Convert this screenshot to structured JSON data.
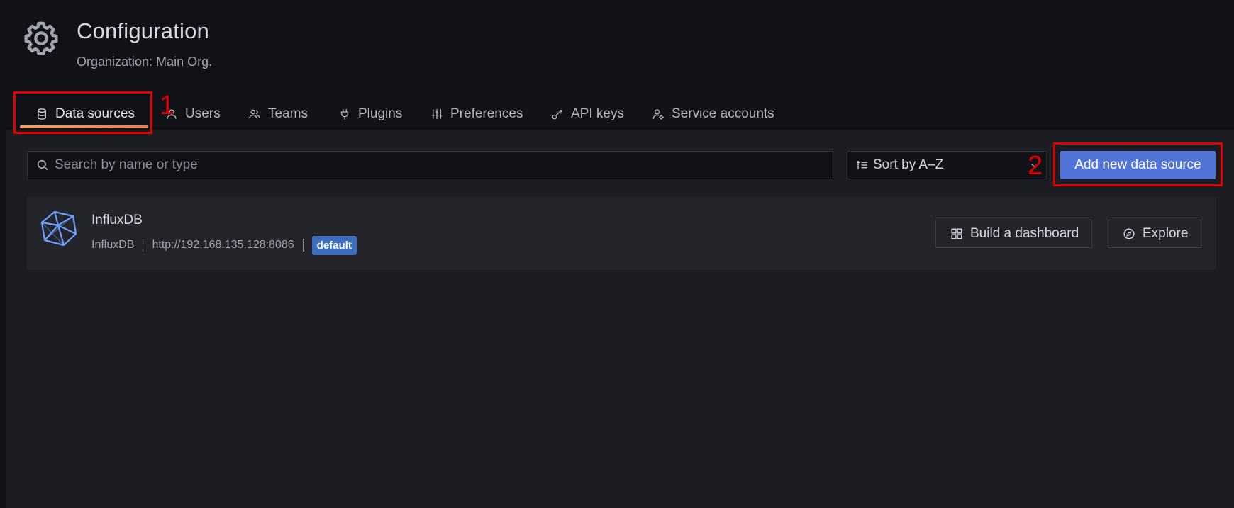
{
  "header": {
    "title": "Configuration",
    "subtitle": "Organization: Main Org."
  },
  "tabs": [
    {
      "label": "Data sources",
      "icon": "database-icon",
      "active": true
    },
    {
      "label": "Users",
      "icon": "user-icon",
      "active": false
    },
    {
      "label": "Teams",
      "icon": "users-icon",
      "active": false
    },
    {
      "label": "Plugins",
      "icon": "plug-icon",
      "active": false
    },
    {
      "label": "Preferences",
      "icon": "sliders-icon",
      "active": false
    },
    {
      "label": "API keys",
      "icon": "key-icon",
      "active": false
    },
    {
      "label": "Service accounts",
      "icon": "user-cog-icon",
      "active": false
    }
  ],
  "toolbar": {
    "search_placeholder": "Search by name or type",
    "search_value": "",
    "sort_label": "Sort by A–Z",
    "add_label": "Add new data source"
  },
  "datasources": [
    {
      "name": "InfluxDB",
      "type": "InfluxDB",
      "url": "http://192.168.135.128:8086",
      "badge": "default",
      "actions": {
        "build": "Build a dashboard",
        "explore": "Explore"
      }
    }
  ],
  "annotations": [
    {
      "number": "1"
    },
    {
      "number": "2"
    }
  ],
  "colors": {
    "background": "#111217",
    "panel": "#1c1d22",
    "card": "#23252b",
    "primary": "#5274d9",
    "badge": "#3d6ebd",
    "active_tab_accent": "#f2a35b",
    "annotation": "#e00000"
  }
}
